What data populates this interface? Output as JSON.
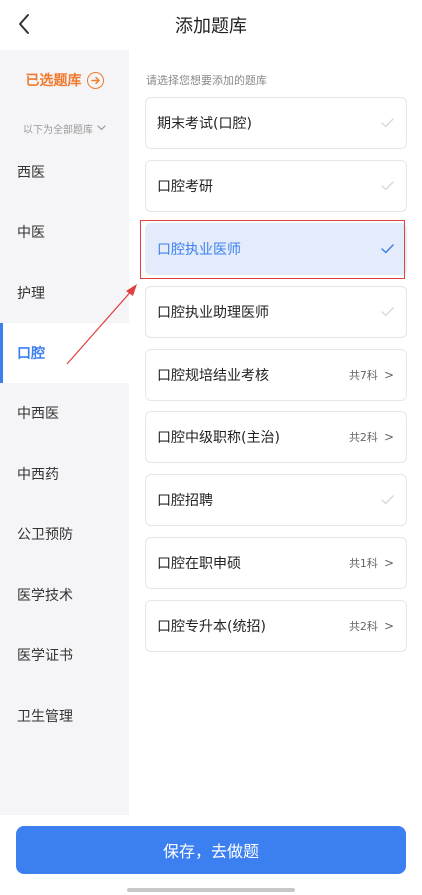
{
  "header": {
    "title": "添加题库"
  },
  "sidebar": {
    "selected_label": "已选题库",
    "all_label": "以下为全部题库",
    "items": [
      {
        "label": "西医"
      },
      {
        "label": "中医"
      },
      {
        "label": "护理"
      },
      {
        "label": "口腔",
        "active": true
      },
      {
        "label": "中西医"
      },
      {
        "label": "中西药"
      },
      {
        "label": "公卫预防"
      },
      {
        "label": "医学技术"
      },
      {
        "label": "医学证书"
      },
      {
        "label": "卫生管理"
      }
    ]
  },
  "content": {
    "hint": "请选择您想要添加的题库",
    "cards": [
      {
        "label": "期末考试(口腔)",
        "type": "check"
      },
      {
        "label": "口腔考研",
        "type": "check"
      },
      {
        "label": "口腔执业医师",
        "type": "check",
        "selected": true
      },
      {
        "label": "口腔执业助理医师",
        "type": "check"
      },
      {
        "label": "口腔规培结业考核",
        "type": "sub",
        "count": "共7科",
        "arrow": ">"
      },
      {
        "label": "口腔中级职称(主治)",
        "type": "sub",
        "count": "共2科",
        "arrow": ">"
      },
      {
        "label": "口腔招聘",
        "type": "check"
      },
      {
        "label": "口腔在职申硕",
        "type": "sub",
        "count": "共1科",
        "arrow": ">"
      },
      {
        "label": "口腔专升本(统招)",
        "type": "sub",
        "count": "共2科",
        "arrow": ">"
      }
    ]
  },
  "footer": {
    "save_label": "保存，去做题"
  },
  "colors": {
    "accent": "#3b7ff0",
    "orange": "#f07b2e",
    "annotation_red": "#e04040",
    "selected_bg": "#e4ecfb"
  },
  "icons": {
    "back": "chevron-left-icon",
    "selected_lib": "arrow-right-circle-icon",
    "all_lib": "chevron-down-icon",
    "check": "check-icon"
  }
}
